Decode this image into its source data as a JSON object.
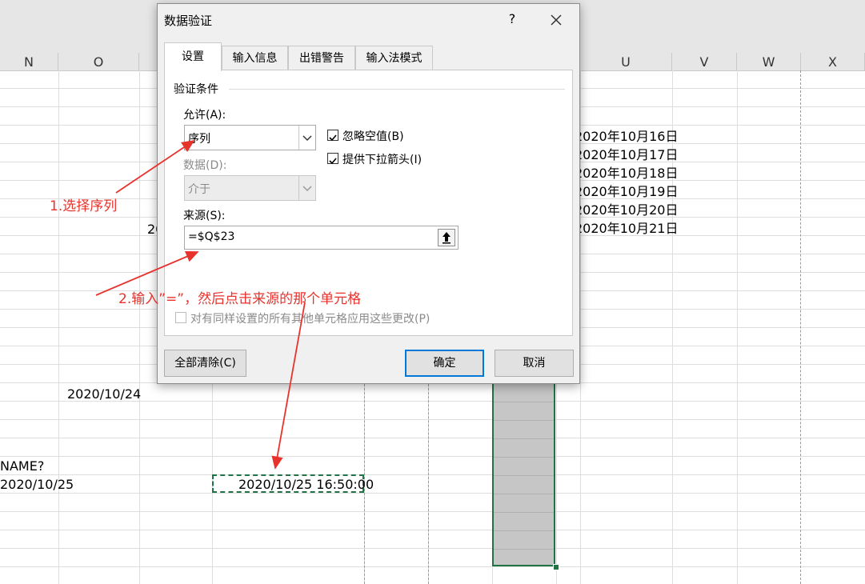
{
  "sheet": {
    "columns": [
      {
        "name": "col-n",
        "label": "N"
      },
      {
        "name": "col-o",
        "label": "O"
      },
      {
        "name": "col-u",
        "label": "U"
      },
      {
        "name": "col-v",
        "label": "V"
      },
      {
        "name": "col-w",
        "label": "W"
      },
      {
        "name": "col-x",
        "label": "X"
      }
    ],
    "dates_list": [
      "2020年10月16日",
      "2020年10月17日",
      "2020年10月18日",
      "2020年10月19日",
      "2020年10月20日",
      "2020年10月21日"
    ],
    "partial_20": "20",
    "o_date": "2020/10/24",
    "name_error": "NAME?",
    "n_date": "2020/10/25",
    "datetime": "2020/10/25 16:50:00"
  },
  "dialog": {
    "title": "数据验证",
    "help": "?",
    "tabs": [
      "设置",
      "输入信息",
      "出错警告",
      "输入法模式"
    ],
    "section": "验证条件",
    "allow_label": "允许(A):",
    "allow_value": "序列",
    "data_label": "数据(D):",
    "data_value": "介于",
    "ignore_blank": "忽略空值(B)",
    "dropdown_arrow": "提供下拉箭头(I)",
    "source_label": "来源(S):",
    "source_value": "=$Q$23",
    "apply_all": "对有同样设置的所有其他单元格应用这些更改(P)",
    "clear_all": "全部清除(C)",
    "ok": "确定",
    "cancel": "取消"
  },
  "annotations": {
    "step1": "1.选择序列",
    "step2": "2.输入”=”，然后点击来源的那个单元格"
  },
  "colors": {
    "accent": "#e8332d",
    "selection": "#217346",
    "focus": "#0078d7"
  }
}
